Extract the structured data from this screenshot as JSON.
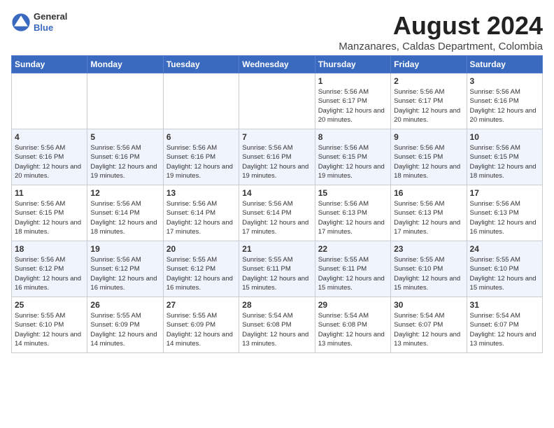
{
  "header": {
    "logo_general": "General",
    "logo_blue": "Blue",
    "title": "August 2024",
    "subtitle": "Manzanares, Caldas Department, Colombia"
  },
  "days_of_week": [
    "Sunday",
    "Monday",
    "Tuesday",
    "Wednesday",
    "Thursday",
    "Friday",
    "Saturday"
  ],
  "weeks": [
    [
      {
        "day": "",
        "info": ""
      },
      {
        "day": "",
        "info": ""
      },
      {
        "day": "",
        "info": ""
      },
      {
        "day": "",
        "info": ""
      },
      {
        "day": "1",
        "info": "Sunrise: 5:56 AM\nSunset: 6:17 PM\nDaylight: 12 hours\nand 20 minutes."
      },
      {
        "day": "2",
        "info": "Sunrise: 5:56 AM\nSunset: 6:17 PM\nDaylight: 12 hours\nand 20 minutes."
      },
      {
        "day": "3",
        "info": "Sunrise: 5:56 AM\nSunset: 6:16 PM\nDaylight: 12 hours\nand 20 minutes."
      }
    ],
    [
      {
        "day": "4",
        "info": "Sunrise: 5:56 AM\nSunset: 6:16 PM\nDaylight: 12 hours\nand 20 minutes."
      },
      {
        "day": "5",
        "info": "Sunrise: 5:56 AM\nSunset: 6:16 PM\nDaylight: 12 hours\nand 19 minutes."
      },
      {
        "day": "6",
        "info": "Sunrise: 5:56 AM\nSunset: 6:16 PM\nDaylight: 12 hours\nand 19 minutes."
      },
      {
        "day": "7",
        "info": "Sunrise: 5:56 AM\nSunset: 6:16 PM\nDaylight: 12 hours\nand 19 minutes."
      },
      {
        "day": "8",
        "info": "Sunrise: 5:56 AM\nSunset: 6:15 PM\nDaylight: 12 hours\nand 19 minutes."
      },
      {
        "day": "9",
        "info": "Sunrise: 5:56 AM\nSunset: 6:15 PM\nDaylight: 12 hours\nand 18 minutes."
      },
      {
        "day": "10",
        "info": "Sunrise: 5:56 AM\nSunset: 6:15 PM\nDaylight: 12 hours\nand 18 minutes."
      }
    ],
    [
      {
        "day": "11",
        "info": "Sunrise: 5:56 AM\nSunset: 6:15 PM\nDaylight: 12 hours\nand 18 minutes."
      },
      {
        "day": "12",
        "info": "Sunrise: 5:56 AM\nSunset: 6:14 PM\nDaylight: 12 hours\nand 18 minutes."
      },
      {
        "day": "13",
        "info": "Sunrise: 5:56 AM\nSunset: 6:14 PM\nDaylight: 12 hours\nand 17 minutes."
      },
      {
        "day": "14",
        "info": "Sunrise: 5:56 AM\nSunset: 6:14 PM\nDaylight: 12 hours\nand 17 minutes."
      },
      {
        "day": "15",
        "info": "Sunrise: 5:56 AM\nSunset: 6:13 PM\nDaylight: 12 hours\nand 17 minutes."
      },
      {
        "day": "16",
        "info": "Sunrise: 5:56 AM\nSunset: 6:13 PM\nDaylight: 12 hours\nand 17 minutes."
      },
      {
        "day": "17",
        "info": "Sunrise: 5:56 AM\nSunset: 6:13 PM\nDaylight: 12 hours\nand 16 minutes."
      }
    ],
    [
      {
        "day": "18",
        "info": "Sunrise: 5:56 AM\nSunset: 6:12 PM\nDaylight: 12 hours\nand 16 minutes."
      },
      {
        "day": "19",
        "info": "Sunrise: 5:56 AM\nSunset: 6:12 PM\nDaylight: 12 hours\nand 16 minutes."
      },
      {
        "day": "20",
        "info": "Sunrise: 5:55 AM\nSunset: 6:12 PM\nDaylight: 12 hours\nand 16 minutes."
      },
      {
        "day": "21",
        "info": "Sunrise: 5:55 AM\nSunset: 6:11 PM\nDaylight: 12 hours\nand 15 minutes."
      },
      {
        "day": "22",
        "info": "Sunrise: 5:55 AM\nSunset: 6:11 PM\nDaylight: 12 hours\nand 15 minutes."
      },
      {
        "day": "23",
        "info": "Sunrise: 5:55 AM\nSunset: 6:10 PM\nDaylight: 12 hours\nand 15 minutes."
      },
      {
        "day": "24",
        "info": "Sunrise: 5:55 AM\nSunset: 6:10 PM\nDaylight: 12 hours\nand 15 minutes."
      }
    ],
    [
      {
        "day": "25",
        "info": "Sunrise: 5:55 AM\nSunset: 6:10 PM\nDaylight: 12 hours\nand 14 minutes."
      },
      {
        "day": "26",
        "info": "Sunrise: 5:55 AM\nSunset: 6:09 PM\nDaylight: 12 hours\nand 14 minutes."
      },
      {
        "day": "27",
        "info": "Sunrise: 5:55 AM\nSunset: 6:09 PM\nDaylight: 12 hours\nand 14 minutes."
      },
      {
        "day": "28",
        "info": "Sunrise: 5:54 AM\nSunset: 6:08 PM\nDaylight: 12 hours\nand 13 minutes."
      },
      {
        "day": "29",
        "info": "Sunrise: 5:54 AM\nSunset: 6:08 PM\nDaylight: 12 hours\nand 13 minutes."
      },
      {
        "day": "30",
        "info": "Sunrise: 5:54 AM\nSunset: 6:07 PM\nDaylight: 12 hours\nand 13 minutes."
      },
      {
        "day": "31",
        "info": "Sunrise: 5:54 AM\nSunset: 6:07 PM\nDaylight: 12 hours\nand 13 minutes."
      }
    ]
  ]
}
